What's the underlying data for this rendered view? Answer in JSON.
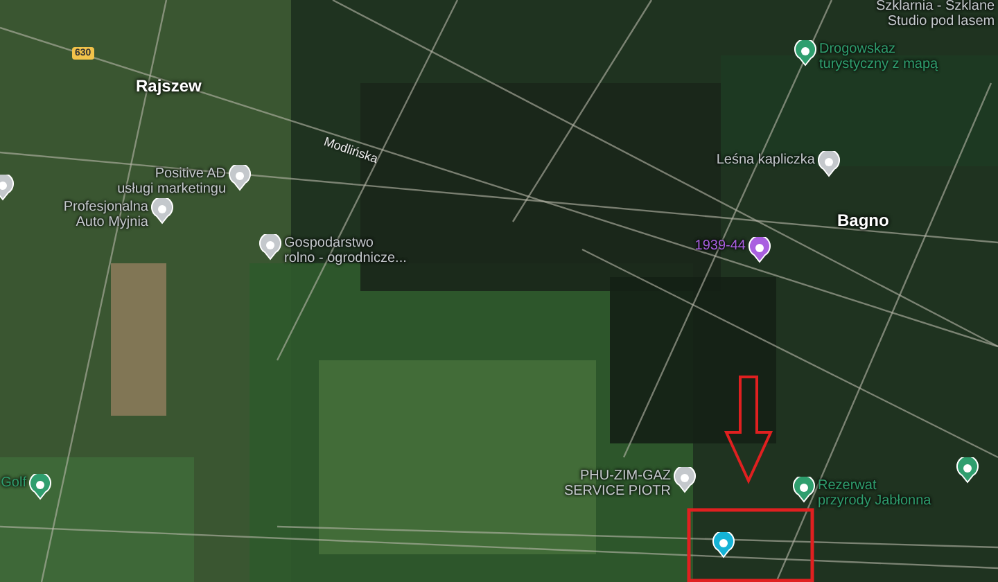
{
  "map": {
    "places": [
      {
        "kind": "road_badge",
        "text": "630"
      },
      {
        "kind": "place",
        "text": "Rajszew"
      },
      {
        "kind": "road_name",
        "text": "Modlińska"
      },
      {
        "kind": "place",
        "text": "Bagno"
      },
      {
        "kind": "poi_text",
        "text": "Szklarnia - Szklane\nStudio pod lasem"
      }
    ],
    "pois": [
      {
        "label": "Drogowskaz\nturystyczny z mapą",
        "color": "#2f9e6e"
      },
      {
        "label": "Positive AD\nusługi marketingu",
        "color": "#c4c8cc"
      },
      {
        "color": "#c4c8cc"
      },
      {
        "label": "Profesjonalna\nAuto Myjnia",
        "color": "#c4c8cc"
      },
      {
        "label": "Gospodarstwo\nrolno - ogrodnicze...",
        "color": "#c4c8cc"
      },
      {
        "label": "Leśna kapliczka",
        "color": "#c4c8cc"
      },
      {
        "label": "1939-44",
        "color": "#a95fe0"
      },
      {
        "label": "Golf",
        "color": "#2f9e6e"
      },
      {
        "label": "PHU-ZIM-GAZ\nSERVICE PIOTR",
        "color": "#c4c8cc"
      },
      {
        "label": "Rezerwat\nprzyrody Jabłonna",
        "color": "#2f9e6e"
      },
      {
        "color": "#2f9e6e"
      },
      {
        "color": "#15b3d6"
      }
    ]
  }
}
